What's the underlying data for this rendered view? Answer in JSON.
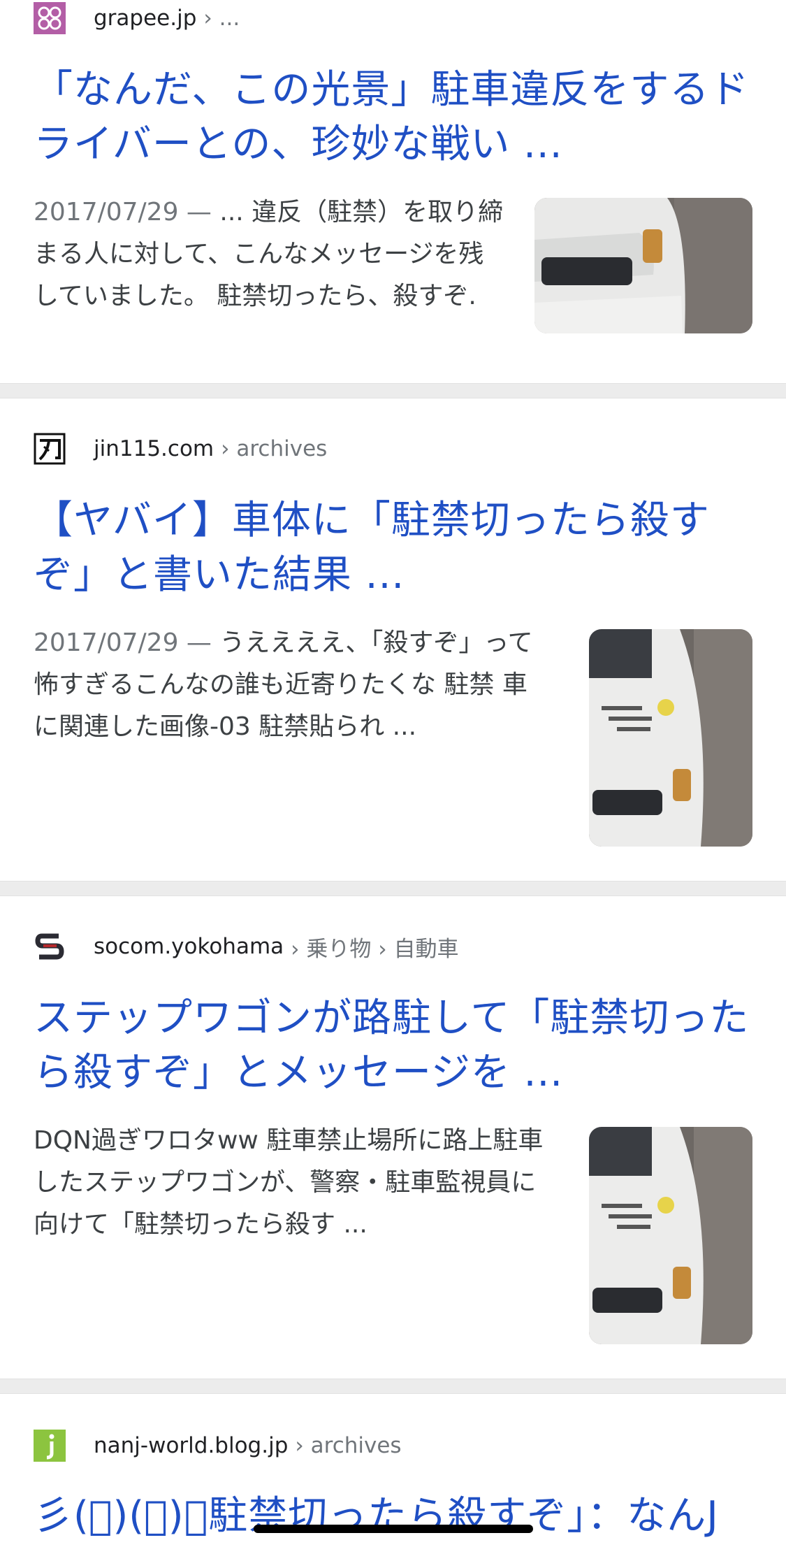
{
  "results": [
    {
      "site": "grapee.jp",
      "path": "› ...",
      "favicon": "flower-logo-icon",
      "title": "「なんだ、この光景」駐車違反をするドライバーとの、珍妙な戦い ...",
      "date": "2017/07/29 —",
      "snippet": "... 違反（駐禁）を取り締まる人に対して、こんなメッセージを残していました。 駐禁切ったら、殺すぞ."
    },
    {
      "site": "jin115.com",
      "path": "› archives",
      "favicon": "jin-logo-icon",
      "title": "【ヤバイ】車体に「駐禁切ったら殺すぞ」と書いた結果 ...",
      "date": "2017/07/29 —",
      "snippet": "うええええ、「殺すぞ」って怖すぎるこんなの誰も近寄りたくな 駐禁 車に関連した画像-03 駐禁貼られ ..."
    },
    {
      "site": "socom.yokohama",
      "path": "› 乗り物 › 自動車",
      "favicon": "s-logo-icon",
      "title": "ステップワゴンが路駐して「駐禁切ったら殺すぞ」とメッセージを ...",
      "date": "",
      "snippet": "DQN過ぎワロタww 駐車禁止場所に路上駐車したステップワゴンが、警察・駐車監視員に向けて「駐禁切ったら殺す ..."
    },
    {
      "site": "nanj-world.blog.jp",
      "path": "› archives",
      "favicon": "j-logo-icon",
      "title": "彡(゚)(゚)「駐禁切ったら殺すぞ」：なんJ"
    }
  ],
  "colors": {
    "title": "#1f4fc4",
    "separator": "#ececec"
  }
}
